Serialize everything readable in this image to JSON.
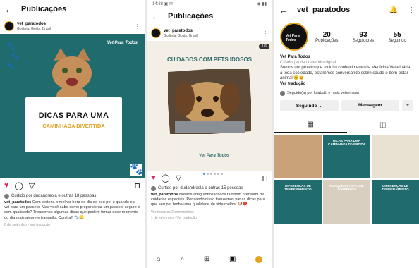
{
  "screen1": {
    "title": "Publicações",
    "post": {
      "username": "vet_paratodos",
      "location": "Goiânia, Goiás, Brasil",
      "brand": "Vet Para Todos",
      "card_line1": "DICAS PARA UMA",
      "card_line2": "CAMINHADA DIVERTIDA",
      "liked_by": "Curtido por dudandreola e outras 18 pessoas",
      "caption_user": "vet_paratodos",
      "caption": "Com certeza o melhor hora do dia do seu pet é quando ele vai para um passeio. Mas você sabe como proporcionar um passeio seguro e com qualidade? Trouxemos algumas dicas que podem tornar esse momento do dia mais alegre e tranquilo. Confira!! 🐾😊",
      "meta": "8 de setembro · Ver tradução"
    },
    "colors": {
      "primary": "#1f6b6d",
      "accent": "#e0a020"
    }
  },
  "screen2": {
    "status": "14:38 ▣ ✉ ·",
    "status_right": "◉ ▮▮",
    "title": "Publicações",
    "post": {
      "username": "vet_paratodos",
      "location": "Goiânia, Goiás, Brasil",
      "counter": "1/6",
      "media_title": "CUIDADOS COM PETS IDOSOS",
      "brand": "Vet Para Todos",
      "liked_by": "Curtido por dudandreola e outras 15 pessoas",
      "caption_user": "vet_paratodos",
      "caption": "Nossos amiguinhos idosos também precisam de cuidados especiais. Pensando nisso trouxemos várias dicas para que seu pet tenha uma qualidade de vida melhor 🐶❤️",
      "meta": "Ver todos os 2 comentários",
      "meta2": "1 de setembro · Ver tradução"
    }
  },
  "screen3": {
    "username": "vet_paratodos",
    "avatar_text": "Vet Para Todos",
    "stats": [
      {
        "n": "20",
        "l": "Publicações"
      },
      {
        "n": "93",
        "l": "Seguidores"
      },
      {
        "n": "55",
        "l": "Seguindo"
      }
    ],
    "name": "Vet Para Todos",
    "category": "Criador(a) de conteúdo digital",
    "bio": "Somos um projeto que inclui o conhecimento da Medicina Veterinária a toda sociedade, estaremos conversando sobre saúde e bem-estar animal 😊🐱",
    "translate": "Ver tradução",
    "followed_by": "Seguido(a) por lolabotti e mais veterinaria",
    "btn_following": "Seguindo ⌄",
    "btn_message": "Mensagem",
    "btn_more": "+",
    "tiles": [
      {
        "label": "",
        "bg": "#c9a27a"
      },
      {
        "label": "DICAS PARA UMA CAMINHADA DIVERTIDA",
        "bg": "#1f6b6d"
      },
      {
        "label": "",
        "bg": "#e9e1d2"
      },
      {
        "label": "DIFERENÇAS DE TEMPERAMENTO",
        "bg": "#1f6b6d"
      },
      {
        "label": "PORQUE PETS FICAM SOZINHOS?",
        "bg": "#d8cfc0"
      },
      {
        "label": "DIFERENÇAS DE TEMPERAMENTO",
        "bg": "#1f6b6d"
      }
    ]
  }
}
